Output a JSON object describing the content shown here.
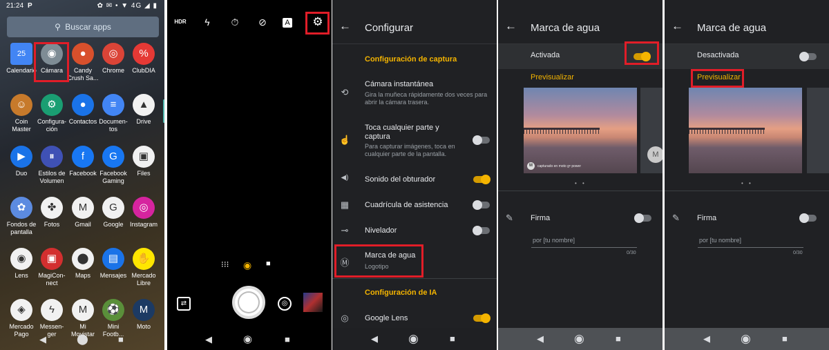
{
  "panel1": {
    "status": {
      "time": "21:24",
      "prefix": "P",
      "right": "✿ ✉ • ▼ 4G ◢ ▮"
    },
    "search": {
      "placeholder": "Buscar apps"
    },
    "apps": [
      {
        "label": "Calendario",
        "icon": "calendar-icon",
        "glyph": "25",
        "color": "#4285f4"
      },
      {
        "label": "Cámara",
        "icon": "camera-icon",
        "glyph": "◉",
        "color": "#7e8c95"
      },
      {
        "label": "Candy\nCrush Sa...",
        "icon": "candy-icon",
        "glyph": "●",
        "color": "#d8502c"
      },
      {
        "label": "Chrome",
        "icon": "chrome-icon",
        "glyph": "◎",
        "color": "#db4437"
      },
      {
        "label": "ClubDIA",
        "icon": "clubdia-icon",
        "glyph": "%",
        "color": "#e53935"
      },
      {
        "label": "Coin\nMaster",
        "icon": "coin-master-icon",
        "glyph": "☺",
        "color": "#c77a2b"
      },
      {
        "label": "Configura-\nción",
        "icon": "settings-icon",
        "glyph": "⚙",
        "color": "#1a9e72"
      },
      {
        "label": "Contactos",
        "icon": "contacts-icon",
        "glyph": "●",
        "color": "#1a73e8"
      },
      {
        "label": "Documen-\ntos",
        "icon": "docs-icon",
        "glyph": "≡",
        "color": "#4285f4"
      },
      {
        "label": "Drive",
        "icon": "drive-icon",
        "glyph": "▲",
        "color": "#f1f1f1"
      },
      {
        "label": "Duo",
        "icon": "duo-icon",
        "glyph": "▶",
        "color": "#1a73e8"
      },
      {
        "label": "Estilos de\nVolumen",
        "icon": "volume-styles-icon",
        "glyph": "⏸",
        "color": "#3f51b5"
      },
      {
        "label": "Facebook",
        "icon": "facebook-icon",
        "glyph": "f",
        "color": "#1877f2"
      },
      {
        "label": "Facebook\nGaming",
        "icon": "facebook-gaming-icon",
        "glyph": "G",
        "color": "#1877f2"
      },
      {
        "label": "Files",
        "icon": "files-icon",
        "glyph": "▣",
        "color": "#f1f1f1"
      },
      {
        "label": "Fondos de\npantalla",
        "icon": "wallpapers-icon",
        "glyph": "✿",
        "color": "#5c8be0"
      },
      {
        "label": "Fotos",
        "icon": "photos-icon",
        "glyph": "✤",
        "color": "#f1f1f1"
      },
      {
        "label": "Gmail",
        "icon": "gmail-icon",
        "glyph": "M",
        "color": "#f1f1f1"
      },
      {
        "label": "Google",
        "icon": "google-icon",
        "glyph": "G",
        "color": "#f1f1f1"
      },
      {
        "label": "Instagram",
        "icon": "instagram-icon",
        "glyph": "◎",
        "color": "#d6249f"
      },
      {
        "label": "Lens",
        "icon": "lens-icon",
        "glyph": "◉",
        "color": "#f1f1f1"
      },
      {
        "label": "MagiCon-\nnect",
        "icon": "magiconnect-icon",
        "glyph": "▣",
        "color": "#d32f2f"
      },
      {
        "label": "Maps",
        "icon": "maps-icon",
        "glyph": "⬤",
        "color": "#f1f1f1"
      },
      {
        "label": "Mensajes",
        "icon": "messages-icon",
        "glyph": "▤",
        "color": "#1a73e8"
      },
      {
        "label": "Mercado\nLibre",
        "icon": "mercado-libre-icon",
        "glyph": "✋",
        "color": "#ffe600"
      },
      {
        "label": "Mercado\nPago",
        "icon": "mercado-pago-icon",
        "glyph": "◈",
        "color": "#f1f1f1"
      },
      {
        "label": "Messen-\nger",
        "icon": "messenger-icon",
        "glyph": "ϟ",
        "color": "#f1f1f1"
      },
      {
        "label": "Mi\nMovistar",
        "icon": "movistar-icon",
        "glyph": "M",
        "color": "#f1f1f1"
      },
      {
        "label": "Mini\nFootb...",
        "icon": "mini-football-icon",
        "glyph": "⚽",
        "color": "#5a8f3a"
      },
      {
        "label": "Moto",
        "icon": "moto-icon",
        "glyph": "M",
        "color": "#1c3a63"
      }
    ],
    "nav": {
      "back": "◀",
      "home": "⬤",
      "recent": "■"
    }
  },
  "panel2": {
    "top_icons": {
      "hdr": "HDR",
      "flash": "ϟ",
      "timer": "⏱",
      "filter": "⊘",
      "a": "A",
      "gear": "⚙"
    },
    "modes": {
      "grid": "⁝⁝⁝",
      "photo": "◉",
      "video": "■"
    },
    "nav": {
      "back": "◀",
      "home": "◉",
      "recent": "■"
    }
  },
  "panel3": {
    "title": "Configurar",
    "back": "←",
    "section_capture": "Configuración de captura",
    "rows": [
      {
        "title": "Cámara instantánea",
        "subtitle": "Gira la muñeca rápidamente dos veces para abrir la cámara trasera.",
        "icon": "⟲",
        "toggle": null
      },
      {
        "title": "Toca cualquier parte y captura",
        "subtitle": "Para capturar imágenes, toca en cualquier parte de la pantalla.",
        "icon": "☝",
        "toggle": false
      },
      {
        "title": "Sonido del obturador",
        "subtitle": "",
        "icon": "◀)",
        "toggle": true
      },
      {
        "title": "Cuadrícula de asistencia",
        "subtitle": "",
        "icon": "▦",
        "toggle": false
      },
      {
        "title": "Nivelador",
        "subtitle": "",
        "icon": "⊸",
        "toggle": false
      },
      {
        "title": "Marca de agua",
        "subtitle": "Logotipo",
        "icon": "Ⓜ",
        "toggle": null
      }
    ],
    "section_ia": "Configuración de IA",
    "lens_row": {
      "title": "Google Lens",
      "icon": "◎",
      "toggle": true
    },
    "nav": {
      "back": "◀",
      "home": "◉",
      "recent": "■"
    }
  },
  "panel4": {
    "title": "Marca de agua",
    "back": "←",
    "status_label": "Activada",
    "status_on": true,
    "preview_label": "Previsualizar",
    "watermark_text": "capturado en moto g⁸ power",
    "firma_label": "Firma",
    "firma_on": false,
    "firma_placeholder": "por [tu nombre]",
    "counter": "0/30",
    "dots": "• •",
    "nav": {
      "back": "◀",
      "home": "◉",
      "recent": "■"
    }
  },
  "panel5": {
    "title": "Marca de agua",
    "back": "←",
    "status_label": "Desactivada",
    "status_on": false,
    "preview_label": "Previsualizar",
    "firma_label": "Firma",
    "firma_on": false,
    "firma_placeholder": "por [tu nombre]",
    "counter": "0/30",
    "dots": "• •",
    "nav": {
      "back": "◀",
      "home": "◉",
      "recent": "■"
    }
  },
  "highlight_color": "#e11d28",
  "accent_color": "#f4b400"
}
